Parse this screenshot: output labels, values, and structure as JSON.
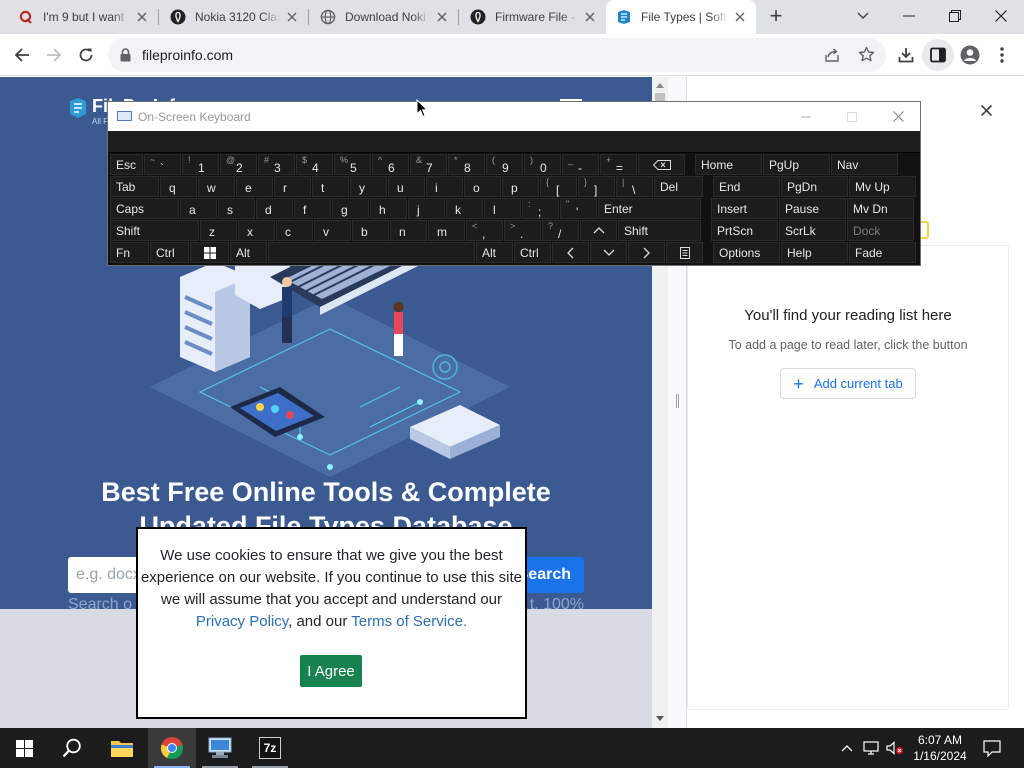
{
  "browser": {
    "tabs": [
      {
        "title": "I'm 9 but I want",
        "favicon": "quora-icon",
        "active": false
      },
      {
        "title": "Nokia 3120 Clas",
        "favicon": "firmware-icon",
        "active": false
      },
      {
        "title": "Download Noki",
        "favicon": "globe-icon",
        "active": false
      },
      {
        "title": "Firmware File - I",
        "favicon": "firmware-icon",
        "active": false
      },
      {
        "title": "File Types | Soft",
        "favicon": "fileproinfo-icon",
        "active": true
      }
    ],
    "new_tab_label": "+",
    "address": "fileproinfo.com"
  },
  "site": {
    "logo_name": "FileProInfo",
    "logo_tagline": "All File Types & Tools",
    "headline_line1": "Best Free Online Tools & Complete",
    "headline_line2": "Updated File Types Database",
    "search_placeholder": "e.g. docx",
    "search_button": "Search",
    "subline_left": "Search o",
    "subline_right": "t, 100%"
  },
  "side_panel": {
    "title": "You'll find your reading list here",
    "subtitle": "To add a page to read later, click the button",
    "add_button": "Add current tab"
  },
  "cookie": {
    "text_before": "We use cookies to ensure that we give you the best experience on our website. If you continue to use this site we will assume that you accept and understand our",
    "privacy_link": "Privacy Policy",
    "middle": ", and our",
    "terms_link": "Terms of Service.",
    "agree": "I Agree"
  },
  "osk": {
    "title": "On-Screen Keyboard",
    "rows": [
      [
        {
          "w": 34,
          "label": "Esc"
        },
        {
          "w": 38,
          "alt": "~",
          "main": "`"
        },
        {
          "w": 38,
          "alt": "!",
          "main": "1"
        },
        {
          "w": 38,
          "alt": "@",
          "main": "2"
        },
        {
          "w": 38,
          "alt": "#",
          "main": "3"
        },
        {
          "w": 38,
          "alt": "$",
          "main": "4"
        },
        {
          "w": 38,
          "alt": "%",
          "main": "5"
        },
        {
          "w": 38,
          "alt": "^",
          "main": "6"
        },
        {
          "w": 38,
          "alt": "&",
          "main": "7"
        },
        {
          "w": 38,
          "alt": "*",
          "main": "8"
        },
        {
          "w": 38,
          "alt": "(",
          "main": "9"
        },
        {
          "w": 38,
          "alt": ")",
          "main": "0"
        },
        {
          "w": 38,
          "alt": "_",
          "main": "-"
        },
        {
          "w": 38,
          "alt": "+",
          "main": "="
        },
        {
          "w": 48,
          "icon": "backspace-icon"
        },
        {
          "gap": 9
        },
        {
          "w": 68,
          "label": "Home"
        },
        {
          "w": 68,
          "label": "PgUp"
        },
        {
          "w": 68,
          "label": "Nav"
        }
      ],
      [
        {
          "w": 50,
          "label": "Tab"
        },
        {
          "w": 38,
          "main": "q"
        },
        {
          "w": 38,
          "main": "w"
        },
        {
          "w": 38,
          "main": "e"
        },
        {
          "w": 38,
          "main": "r"
        },
        {
          "w": 38,
          "main": "t"
        },
        {
          "w": 38,
          "main": "y"
        },
        {
          "w": 38,
          "main": "u"
        },
        {
          "w": 38,
          "main": "i"
        },
        {
          "w": 38,
          "main": "o"
        },
        {
          "w": 38,
          "main": "p"
        },
        {
          "w": 38,
          "alt": "{",
          "main": "["
        },
        {
          "w": 38,
          "alt": "}",
          "main": "]"
        },
        {
          "w": 38,
          "alt": "|",
          "main": "\\"
        },
        {
          "w": 50,
          "label": "Del"
        },
        {
          "gap": 9
        },
        {
          "w": 68,
          "label": "End"
        },
        {
          "w": 68,
          "label": "PgDn"
        },
        {
          "w": 68,
          "label": "Mv Up"
        }
      ],
      [
        {
          "w": 70,
          "label": "Caps"
        },
        {
          "w": 38,
          "main": "a"
        },
        {
          "w": 38,
          "main": "s"
        },
        {
          "w": 38,
          "main": "d"
        },
        {
          "w": 38,
          "main": "f"
        },
        {
          "w": 38,
          "main": "g"
        },
        {
          "w": 38,
          "main": "h"
        },
        {
          "w": 38,
          "main": "j"
        },
        {
          "w": 38,
          "main": "k"
        },
        {
          "w": 38,
          "main": "l"
        },
        {
          "w": 38,
          "alt": ":",
          "main": ";"
        },
        {
          "w": 38,
          "alt": "\"",
          "main": "'"
        },
        {
          "w": 104,
          "label": "Enter"
        },
        {
          "gap": 9
        },
        {
          "w": 68,
          "label": "Insert"
        },
        {
          "w": 68,
          "label": "Pause"
        },
        {
          "w": 68,
          "label": "Mv Dn"
        }
      ],
      [
        {
          "w": 90,
          "label": "Shift"
        },
        {
          "w": 38,
          "main": "z"
        },
        {
          "w": 38,
          "main": "x"
        },
        {
          "w": 38,
          "main": "c"
        },
        {
          "w": 38,
          "main": "v"
        },
        {
          "w": 38,
          "main": "b"
        },
        {
          "w": 38,
          "main": "n"
        },
        {
          "w": 38,
          "main": "m"
        },
        {
          "w": 38,
          "alt": "<",
          "main": ","
        },
        {
          "w": 38,
          "alt": ">",
          "main": "."
        },
        {
          "w": 38,
          "alt": "?",
          "main": "/"
        },
        {
          "w": 38,
          "icon": "arrow-up-icon"
        },
        {
          "w": 84,
          "label": "Shift"
        },
        {
          "gap": 9
        },
        {
          "w": 68,
          "label": "PrtScn"
        },
        {
          "w": 68,
          "label": "ScrLk"
        },
        {
          "w": 68,
          "label": "Dock",
          "dim": true
        }
      ],
      [
        {
          "w": 40,
          "label": "Fn"
        },
        {
          "w": 40,
          "label": "Ctrl"
        },
        {
          "w": 40,
          "icon": "windows-logo-icon"
        },
        {
          "w": 38,
          "label": "Alt"
        },
        {
          "w": 208,
          "label": ""
        },
        {
          "w": 38,
          "label": "Alt"
        },
        {
          "w": 38,
          "label": "Ctrl"
        },
        {
          "w": 38,
          "icon": "arrow-left-icon"
        },
        {
          "w": 38,
          "icon": "arrow-down-icon"
        },
        {
          "w": 38,
          "icon": "arrow-right-icon"
        },
        {
          "w": 38,
          "icon": "menu-key-icon"
        },
        {
          "gap": 9
        },
        {
          "w": 68,
          "label": "Options"
        },
        {
          "w": 68,
          "label": "Help"
        },
        {
          "w": 68,
          "label": "Fade"
        }
      ]
    ]
  },
  "taskbar": {
    "time": "6:07 AM",
    "date": "1/16/2024",
    "apps": [
      "file-explorer-icon",
      "chrome-icon",
      "computer-icon",
      "7zip-icon"
    ],
    "sevenzip_label": "7z"
  },
  "colors": {
    "site_bg": "#3b5a91",
    "accent_blue": "#1a73e8",
    "agree_green": "#17824f",
    "osk_bg": "#111111"
  }
}
